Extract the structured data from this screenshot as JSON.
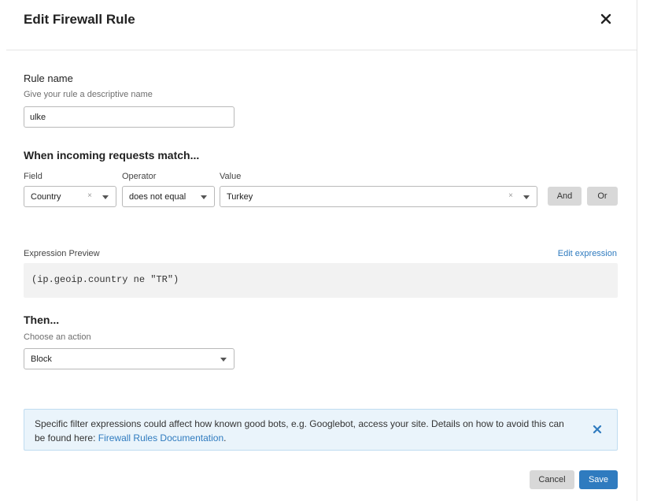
{
  "dialog": {
    "title": "Edit Firewall Rule",
    "close_icon": "close-icon"
  },
  "rule_name": {
    "label": "Rule name",
    "hint": "Give your rule a descriptive name",
    "value": "ulke"
  },
  "match": {
    "title": "When incoming requests match...",
    "field_label": "Field",
    "operator_label": "Operator",
    "value_label": "Value",
    "field_value": "Country",
    "operator_value": "does not equal",
    "value_value": "Turkey",
    "clear_glyph": "×",
    "and_label": "And",
    "or_label": "Or"
  },
  "expression": {
    "label": "Expression Preview",
    "edit_link": "Edit expression",
    "code": "(ip.geoip.country ne \"TR\")"
  },
  "then": {
    "title": "Then...",
    "hint": "Choose an action",
    "action_value": "Block"
  },
  "notice": {
    "text_before": "Specific filter expressions could affect how known good bots, e.g. Googlebot, access your site. Details on how to avoid this can be found here: ",
    "link_text": "Firewall Rules Documentation",
    "text_after": ".",
    "close_icon": "close-icon"
  },
  "footer": {
    "cancel_label": "Cancel",
    "save_label": "Save"
  },
  "colors": {
    "accent": "#2f7bbf",
    "notice_bg": "#eaf4fb",
    "preview_bg": "#f2f2f2",
    "button_gray": "#d8d8d8"
  }
}
